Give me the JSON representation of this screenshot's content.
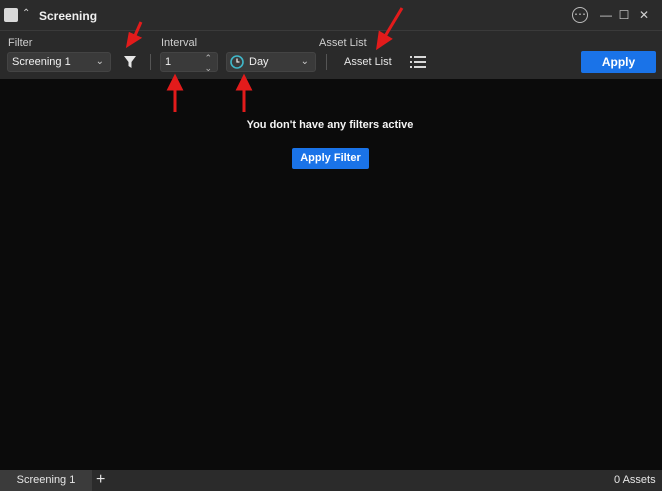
{
  "window": {
    "title": "Screening"
  },
  "toolbar": {
    "filter_label": "Filter",
    "filter_value": "Screening 1",
    "interval_label": "Interval",
    "interval_value": "1",
    "timeframe_value": "Day",
    "asset_list_label": "Asset List",
    "asset_list_button": "Asset List",
    "apply_label": "Apply"
  },
  "main": {
    "empty_message": "You don't have any filters active",
    "apply_filter_label": "Apply Filter"
  },
  "statusbar": {
    "tab_label": "Screening 1",
    "add_tab_symbol": "+",
    "assets_count": "0 Assets"
  },
  "colors": {
    "accent": "#1a73e8",
    "annotation_arrow": "#e31b1b"
  }
}
